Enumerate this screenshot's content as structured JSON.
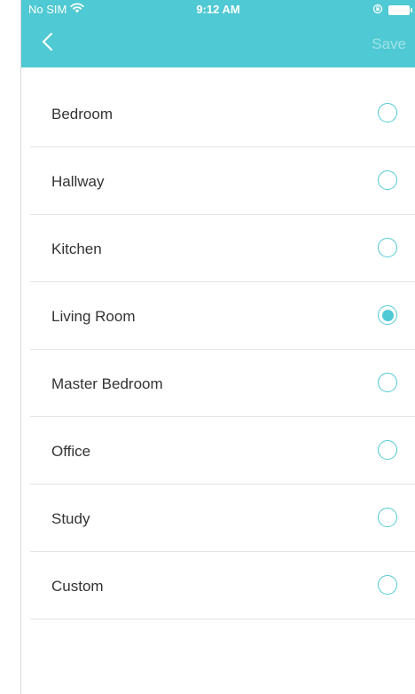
{
  "status_bar": {
    "carrier": "No SIM",
    "time": "9:12 AM"
  },
  "nav": {
    "save_label": "Save"
  },
  "colors": {
    "accent": "#4fc9d3",
    "text": "#333333",
    "divider": "#e3e3e3"
  },
  "rooms": [
    {
      "label": "Bedroom",
      "selected": false
    },
    {
      "label": "Hallway",
      "selected": false
    },
    {
      "label": "Kitchen",
      "selected": false
    },
    {
      "label": "Living Room",
      "selected": true
    },
    {
      "label": "Master Bedroom",
      "selected": false
    },
    {
      "label": "Office",
      "selected": false
    },
    {
      "label": "Study",
      "selected": false
    },
    {
      "label": "Custom",
      "selected": false
    }
  ]
}
